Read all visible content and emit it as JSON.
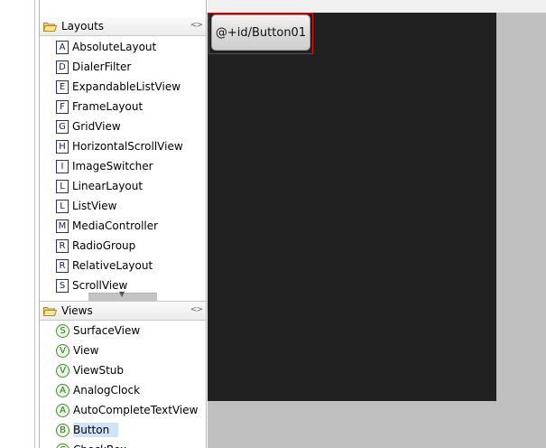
{
  "palette": {
    "layouts_section": {
      "title": "Layouts",
      "collapse_icon": "collapse-arrows-icon",
      "items": [
        {
          "letter": "A",
          "label": "AbsoluteLayout"
        },
        {
          "letter": "D",
          "label": "DialerFilter"
        },
        {
          "letter": "E",
          "label": "ExpandableListView"
        },
        {
          "letter": "F",
          "label": "FrameLayout"
        },
        {
          "letter": "G",
          "label": "GridView"
        },
        {
          "letter": "H",
          "label": "HorizontalScrollView"
        },
        {
          "letter": "I",
          "label": "ImageSwitcher"
        },
        {
          "letter": "L",
          "label": "LinearLayout"
        },
        {
          "letter": "L",
          "label": "ListView"
        },
        {
          "letter": "M",
          "label": "MediaController"
        },
        {
          "letter": "R",
          "label": "RadioGroup"
        },
        {
          "letter": "R",
          "label": "RelativeLayout"
        },
        {
          "letter": "S",
          "label": "ScrollView"
        }
      ]
    },
    "views_section": {
      "title": "Views",
      "collapse_icon": "collapse-arrows-icon",
      "items": [
        {
          "letter": "S",
          "label": "SurfaceView"
        },
        {
          "letter": "V",
          "label": "View"
        },
        {
          "letter": "V",
          "label": "ViewStub"
        },
        {
          "letter": "A",
          "label": "AnalogClock"
        },
        {
          "letter": "A",
          "label": "AutoCompleteTextView"
        },
        {
          "letter": "B",
          "label": "Button",
          "selected": true
        },
        {
          "letter": "C",
          "label": "CheckBox"
        }
      ]
    }
  },
  "canvas": {
    "button_text": "@+id/Button01",
    "screen_color": "#212121",
    "selection_color": "#e01010"
  }
}
